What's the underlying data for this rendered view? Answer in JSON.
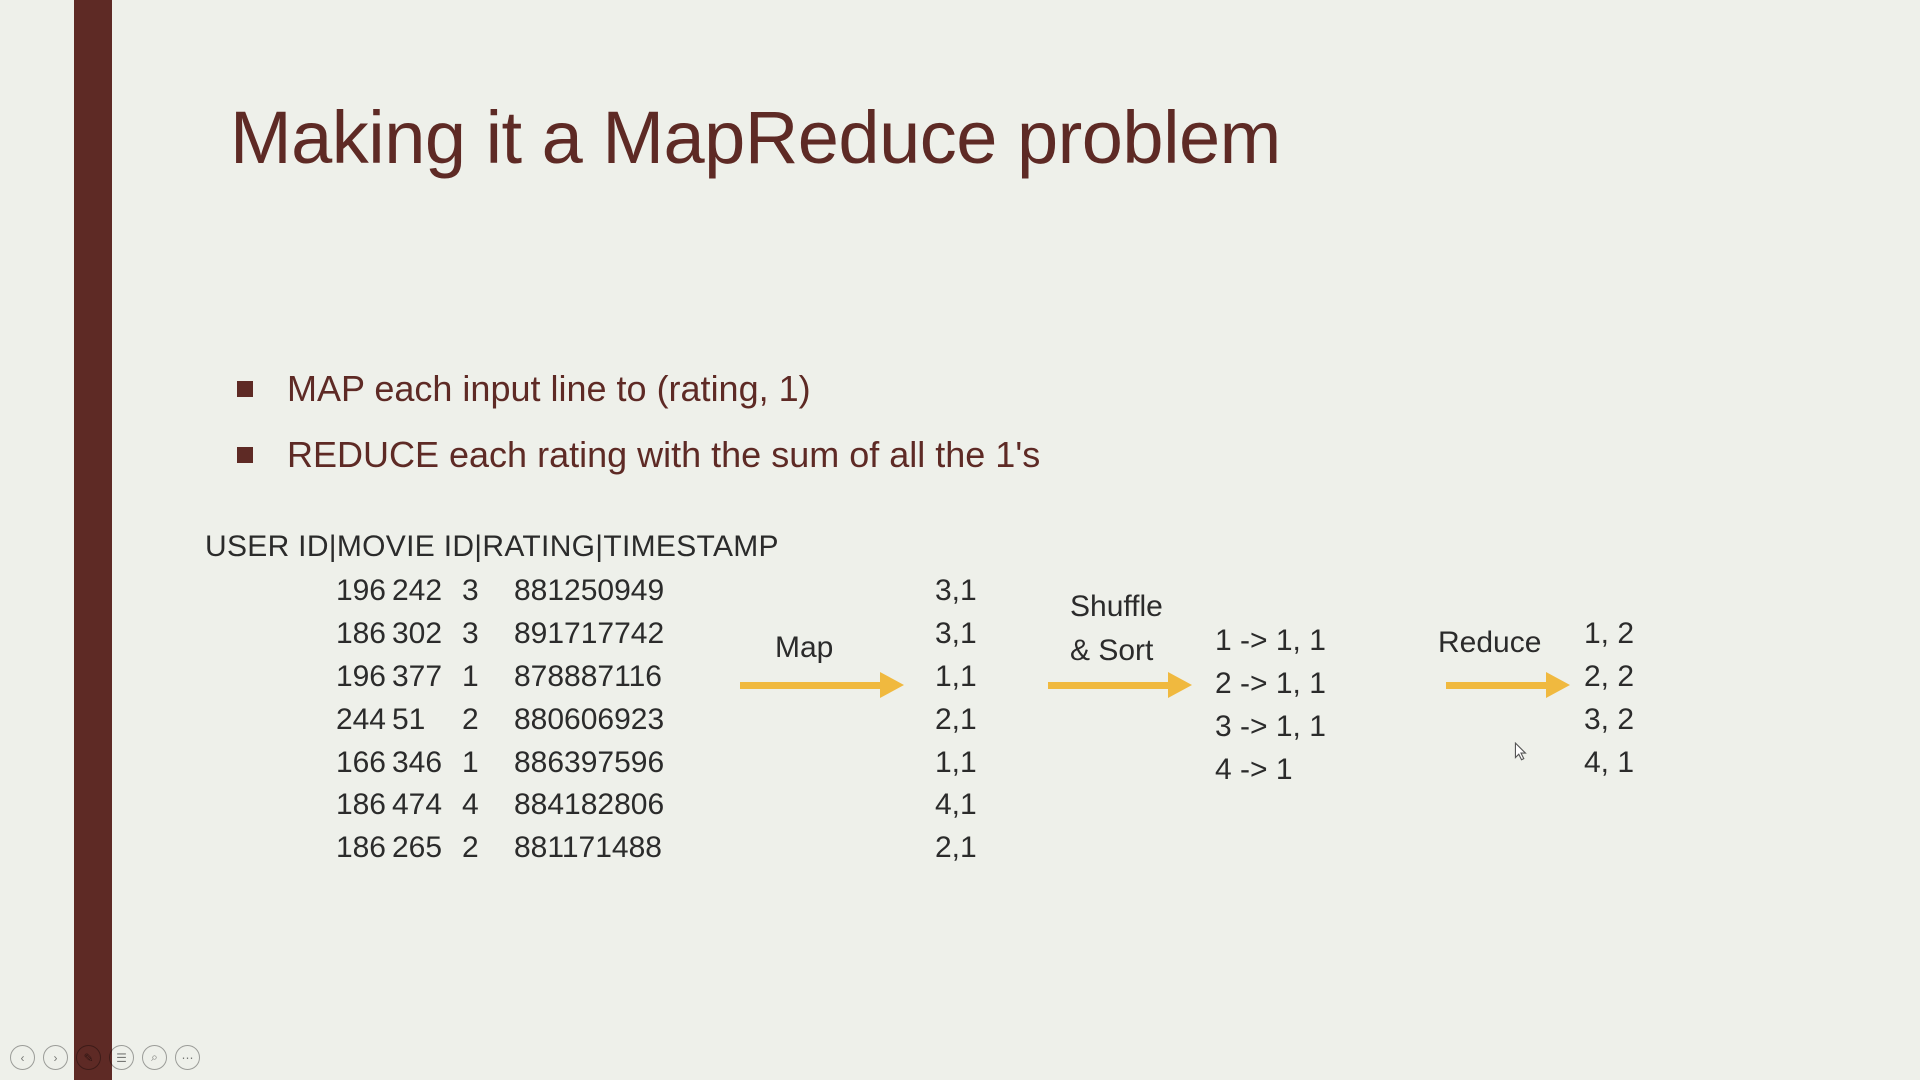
{
  "title": "Making it a MapReduce problem",
  "bullets": [
    "MAP each input line to (rating, 1)",
    "REDUCE each rating with the sum of all the 1's"
  ],
  "dataHeader": "USER ID|MOVIE ID|RATING|TIMESTAMP",
  "rawRows": [
    {
      "user": "196",
      "movie": "242",
      "rating": "3",
      "ts": "881250949"
    },
    {
      "user": "186",
      "movie": "302",
      "rating": "3",
      "ts": "891717742"
    },
    {
      "user": "196",
      "movie": "377",
      "rating": "1",
      "ts": "878887116"
    },
    {
      "user": "244",
      "movie": "51",
      "rating": "2",
      "ts": "880606923"
    },
    {
      "user": "166",
      "movie": "346",
      "rating": "1",
      "ts": "886397596"
    },
    {
      "user": "186",
      "movie": "474",
      "rating": "4",
      "ts": "884182806"
    },
    {
      "user": "186",
      "movie": "265",
      "rating": "2",
      "ts": "881171488"
    }
  ],
  "labels": {
    "map": "Map",
    "shuffle": "Shuffle & Sort",
    "reduce": "Reduce"
  },
  "mapOutput": [
    "3,1",
    "3,1",
    "1,1",
    "2,1",
    "1,1",
    "4,1",
    "2,1"
  ],
  "shuffleOutput": [
    "1 -> 1, 1",
    "2 -> 1, 1",
    "3 -> 1, 1",
    "4 -> 1"
  ],
  "reduceOutput": [
    "1, 2",
    "2, 2",
    "3, 2",
    "4, 1"
  ],
  "navIcons": [
    "‹",
    "›",
    "✎",
    "☰",
    "⌕",
    "⋯"
  ]
}
